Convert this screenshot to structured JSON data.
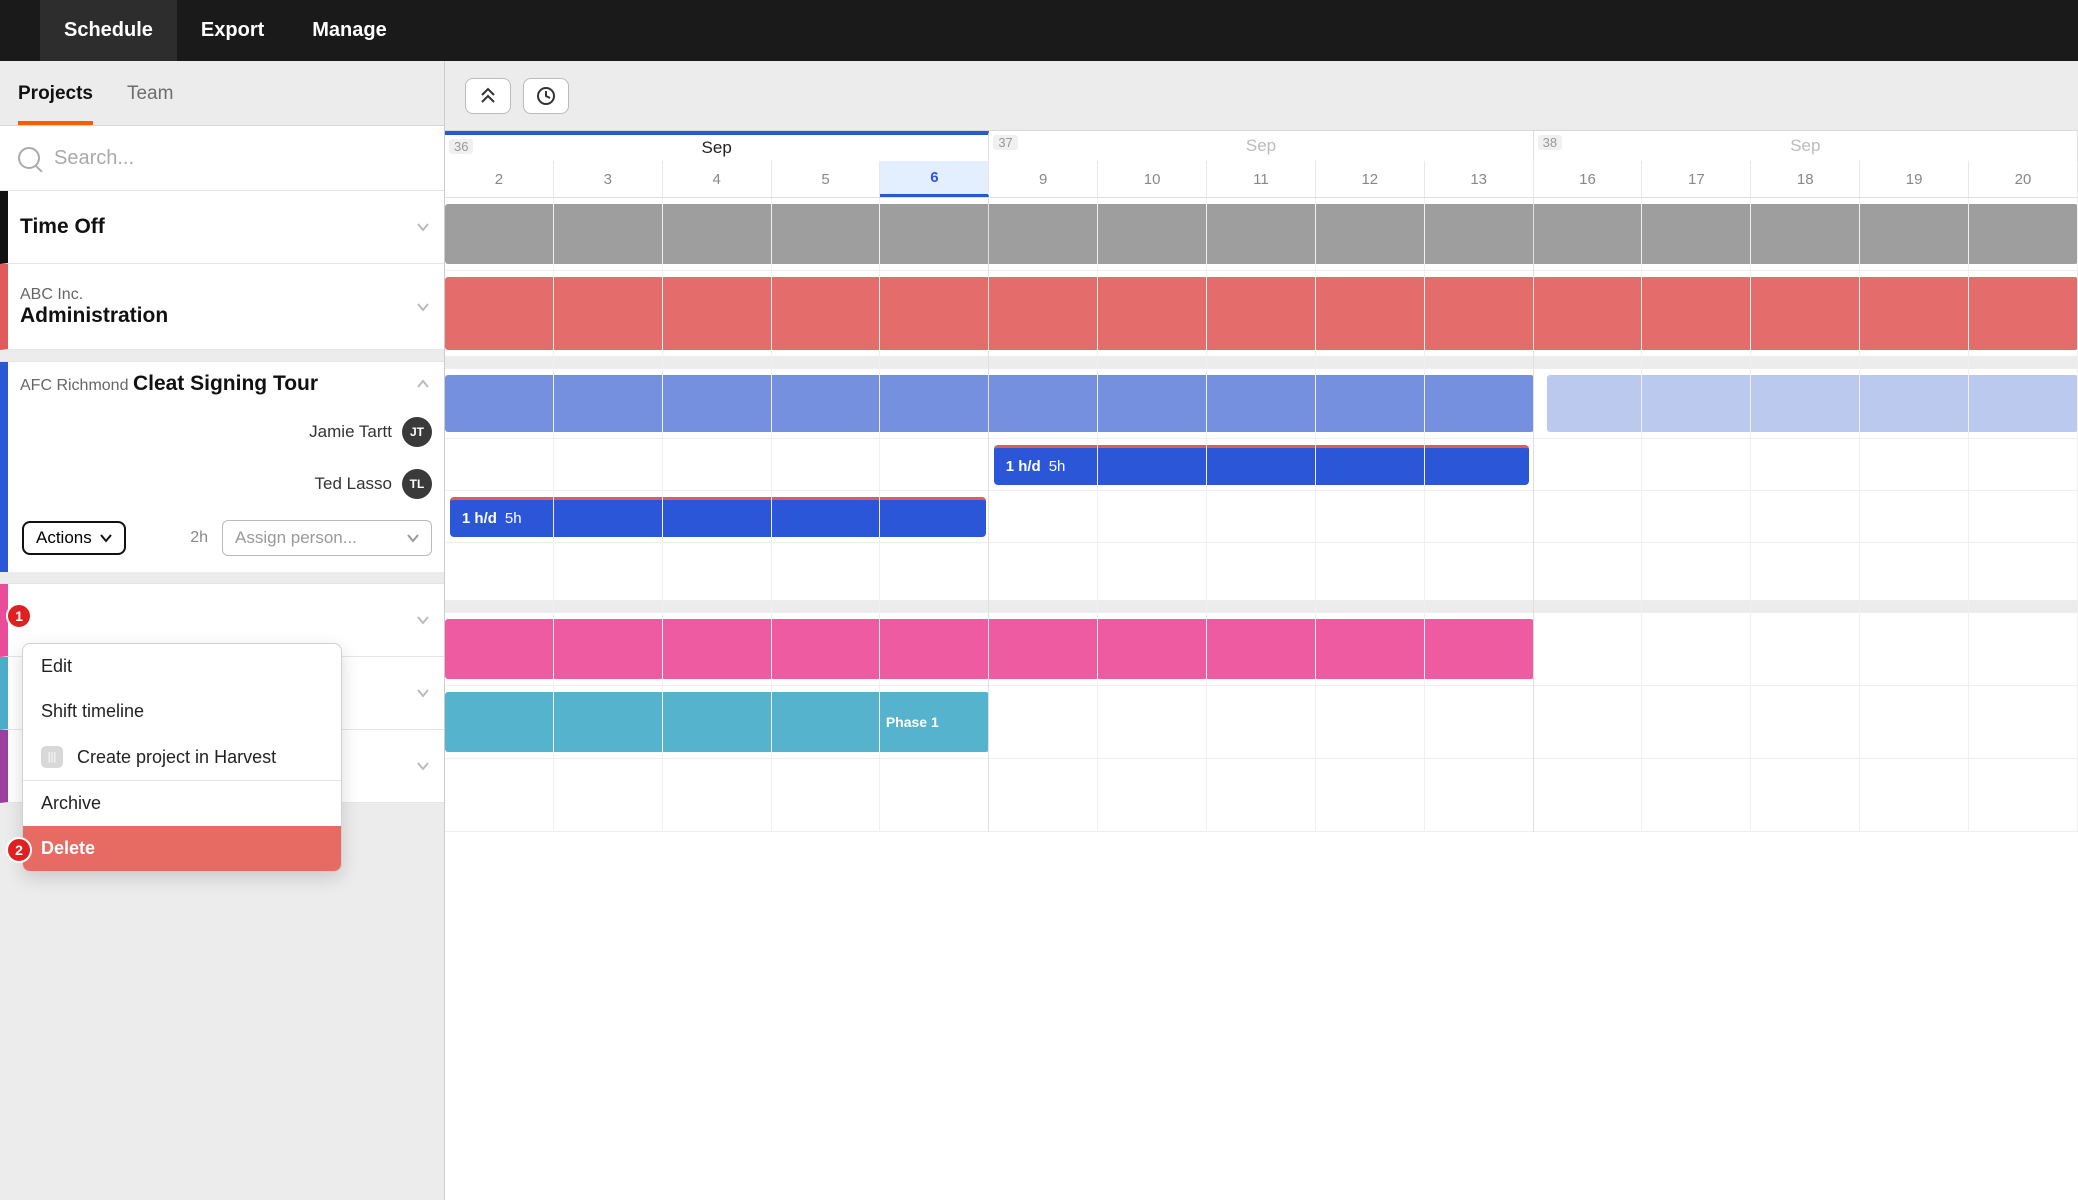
{
  "nav": {
    "schedule": "Schedule",
    "export": "Export",
    "manage": "Manage"
  },
  "sidebar": {
    "tabs": {
      "projects": "Projects",
      "team": "Team"
    },
    "search_placeholder": "Search...",
    "rows": [
      {
        "client": "",
        "project": "Time Off"
      },
      {
        "client": "ABC Inc.",
        "project": "Administration"
      },
      {
        "client": "AFC Richmond",
        "project": "Cleat Signing Tour"
      }
    ],
    "assignees": [
      {
        "name": "Jamie Tartt",
        "initials": "JT"
      },
      {
        "name": "Ted Lasso",
        "initials": "TL"
      }
    ],
    "actions_label": "Actions",
    "hours_label": "2h",
    "assign_placeholder": "Assign person..."
  },
  "dropdown": {
    "edit": "Edit",
    "shift": "Shift timeline",
    "create_harvest": "Create project in Harvest",
    "archive": "Archive",
    "delete": "Delete"
  },
  "annotations": {
    "one": "1",
    "two": "2"
  },
  "timeline": {
    "weeks": [
      {
        "num": "36",
        "label": "Sep",
        "today": true
      },
      {
        "num": "37",
        "label": "Sep",
        "dim": true
      },
      {
        "num": "38",
        "label": "Sep",
        "dim": true
      }
    ],
    "days": [
      "2",
      "3",
      "4",
      "5",
      "6",
      "9",
      "10",
      "11",
      "12",
      "13",
      "16",
      "17",
      "18",
      "19",
      "20"
    ],
    "today_index": 4,
    "assign1": {
      "rate": "1 h/d",
      "total": "5h"
    },
    "assign2": {
      "rate": "1 h/d",
      "total": "5h"
    },
    "phase_label": "Phase 1"
  }
}
